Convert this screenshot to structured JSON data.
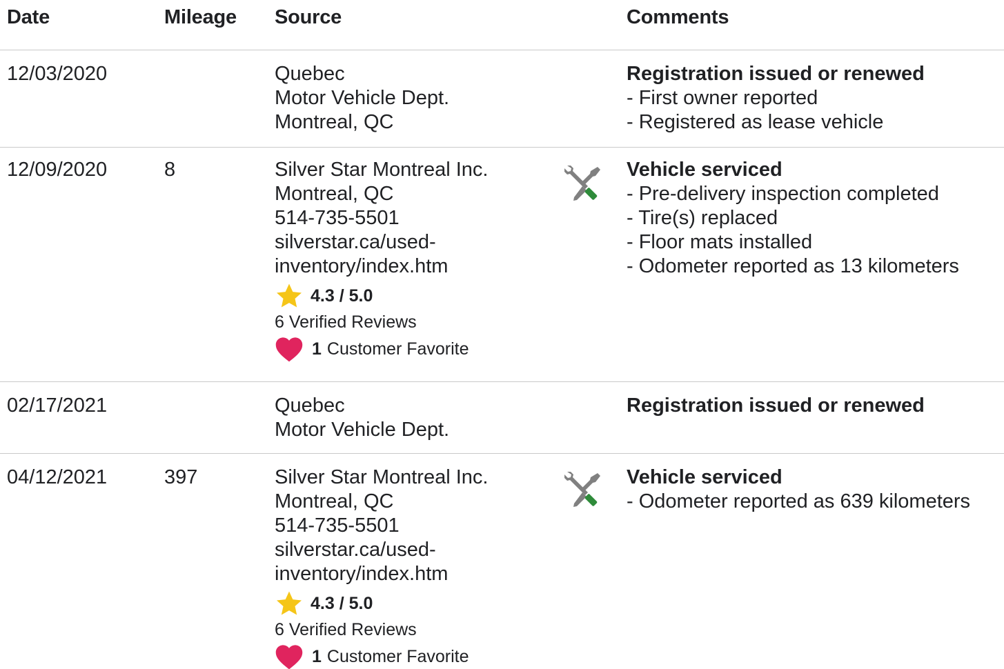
{
  "columns": {
    "date": "Date",
    "mileage": "Mileage",
    "source": "Source",
    "comments": "Comments"
  },
  "records": [
    {
      "date": "12/03/2020",
      "mileage": "",
      "source": [
        "Quebec",
        "Motor Vehicle Dept.",
        "Montreal, QC"
      ],
      "comment_title": "Registration issued or renewed",
      "comment_items": [
        "- First owner reported",
        "- Registered as lease vehicle"
      ]
    },
    {
      "date": "12/09/2020",
      "mileage": "8",
      "source": [
        "Silver Star Montreal Inc.",
        "Montreal, QC",
        "514-735-5501",
        "silverstar.ca/used-",
        "inventory/index.htm"
      ],
      "rating": "4.3 / 5.0",
      "reviews": "6 Verified Reviews",
      "favorite_count": "1",
      "favorite_label": "Customer Favorite",
      "service_icon": "wrench-screwdriver-icon",
      "comment_title": "Vehicle serviced",
      "comment_items": [
        "- Pre-delivery inspection completed",
        "- Tire(s) replaced",
        "- Floor mats installed",
        "- Odometer reported as 13 kilometers"
      ]
    },
    {
      "date": "02/17/2021",
      "mileage": "",
      "source": [
        "Quebec",
        "Motor Vehicle Dept."
      ],
      "comment_title": "Registration issued or renewed",
      "comment_items": []
    },
    {
      "date": "04/12/2021",
      "mileage": "397",
      "source": [
        "Silver Star Montreal Inc.",
        "Montreal, QC",
        "514-735-5501",
        "silverstar.ca/used-",
        "inventory/index.htm"
      ],
      "rating": "4.3 / 5.0",
      "reviews": "6 Verified Reviews",
      "favorite_count": "1",
      "favorite_label": "Customer Favorite",
      "service_icon": "wrench-screwdriver-icon",
      "comment_title": "Vehicle serviced",
      "comment_items": [
        "- Odometer reported as 639 kilometers"
      ]
    }
  ],
  "colors": {
    "star": "#f5c518",
    "heart": "#e0245e",
    "wrench_grey": "#808080",
    "screwdriver_green": "#2e8b3a",
    "divider": "#c9c9c9"
  }
}
